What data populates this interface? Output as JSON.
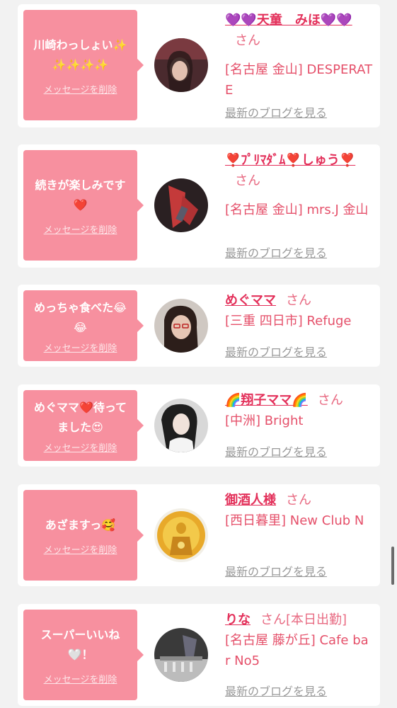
{
  "delete_label": "メッセージを削除",
  "blog_label": "最新のブログを見る",
  "san_label": "さん",
  "cards": [
    {
      "message": "川崎わっしょい✨✨✨✨✨",
      "name": "💜💜天童　みほ💜💜",
      "shop": "[名古屋 金山] DESPERATE"
    },
    {
      "message": "続きが楽しみです❤️",
      "name": "❣️ﾌﾟﾘﾏﾀﾞﾑ❣️しゅう❣️",
      "shop": "[名古屋 金山] mrs.J 金山"
    },
    {
      "message": "めっちゃ食べた😂😂",
      "name": "めぐママ",
      "shop": "[三重 四日市] Refuge"
    },
    {
      "message": "めぐママ❤️待ってました😍",
      "name": "🌈翔子ママ🌈",
      "shop": "[中洲] Bright"
    },
    {
      "message": "あざますっ🥰",
      "name": "御酒人様",
      "shop": "[西日暮里] New Club N"
    },
    {
      "message": "スーパーいいね🤍！",
      "name": "りな",
      "extra": "[本日出勤]",
      "shop": "[名古屋 藤が丘] Cafe bar No5"
    }
  ]
}
